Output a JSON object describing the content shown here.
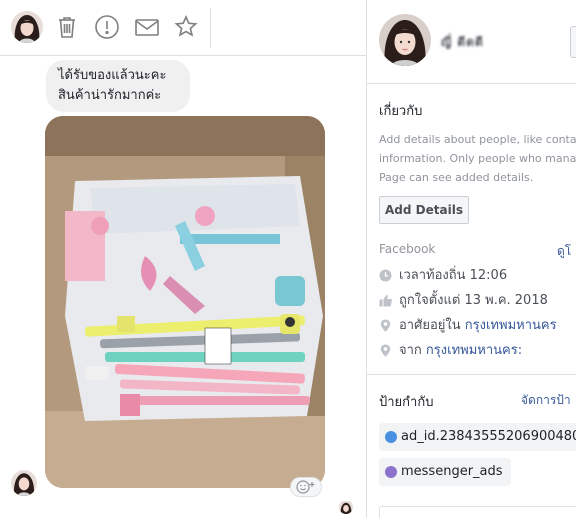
{
  "toolbar": {
    "icons": [
      "avatar",
      "trash-icon",
      "alert-icon",
      "envelope-icon",
      "star-icon"
    ]
  },
  "conversation": {
    "message_line_1": "ได้รับของแล้วนะคะ",
    "message_line_2": "สินค้าน่ารักมากค่ะ"
  },
  "profile": {
    "name": "ญี่ ดีดดี"
  },
  "about": {
    "title": "เกี่ยวกับ",
    "desc_line_1": "Add details about people, like contac",
    "desc_line_2": "information. Only people who manag",
    "desc_line_3": "Page can see added details.",
    "add_details_label": "Add Details"
  },
  "facebook": {
    "label": "Facebook",
    "link": "ดูโ",
    "rows": [
      {
        "icon": "clock-icon",
        "prefix": "เวลาท้องถิ่น 12:06",
        "link": ""
      },
      {
        "icon": "like-icon",
        "prefix": "ถูกใจตั้งแต่ 13 พ.ค. 2018",
        "link": ""
      },
      {
        "icon": "location-icon",
        "prefix": "อาศัยอยู่ใน ",
        "link": "กรุงเทพมหานคร"
      },
      {
        "icon": "location-icon",
        "prefix": "จาก ",
        "link": "กรุงเทพมหานคร:"
      }
    ]
  },
  "labels": {
    "title": "ป้ายกำกับ",
    "manage_link": "จัดการป้า",
    "tags": [
      {
        "text": "ad_id.23843555206900480",
        "color": "#4a90e2"
      },
      {
        "text": "messenger_ads",
        "color": "#8c72cb"
      }
    ]
  },
  "colors": {
    "link": "#365899",
    "muted": "#90949c",
    "border": "#dddfe2"
  }
}
